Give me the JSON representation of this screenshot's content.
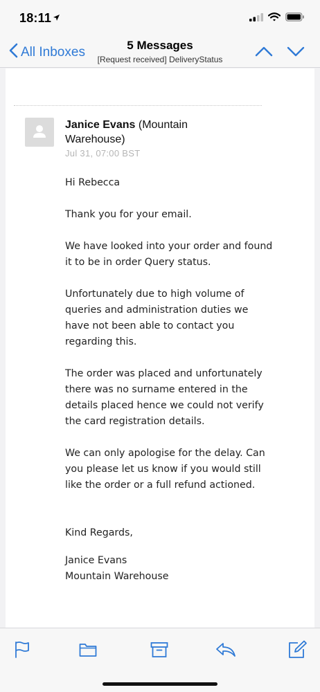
{
  "status_bar": {
    "time": "18:11",
    "icons": [
      "location-arrow-icon",
      "signal-icon",
      "wifi-icon",
      "battery-icon"
    ]
  },
  "nav": {
    "back_label": "All Inboxes",
    "title": "5 Messages",
    "subtitle": "[Request received] DeliveryStatus",
    "icons": [
      "chevron-left-icon",
      "chevron-up-icon",
      "chevron-down-icon"
    ]
  },
  "message": {
    "sender_name": "Janice Evans",
    "sender_org": "(Mountain Warehouse)",
    "date": "Jul 31, 07:00 BST",
    "paragraphs": [
      "Hi Rebecca",
      "Thank you for your email.",
      "We have looked into your order and found it to be in order Query status.",
      "Unfortunately due to high volume of queries and administration duties we have not been able to contact you regarding this.",
      "The order was placed and unfortunately there was no surname entered in the details placed hence we could not verify the card registration details.",
      "We can only apologise for the delay. Can you please let us know if you would still like the order or a full refund actioned."
    ],
    "signoff": "Kind Regards,",
    "signature_name": "Janice Evans",
    "signature_company": "Mountain Warehouse"
  },
  "toolbar": {
    "icons": [
      "flag-icon",
      "folder-icon",
      "archive-icon",
      "reply-icon",
      "compose-icon"
    ],
    "accent_color": "#2f7ad6"
  }
}
